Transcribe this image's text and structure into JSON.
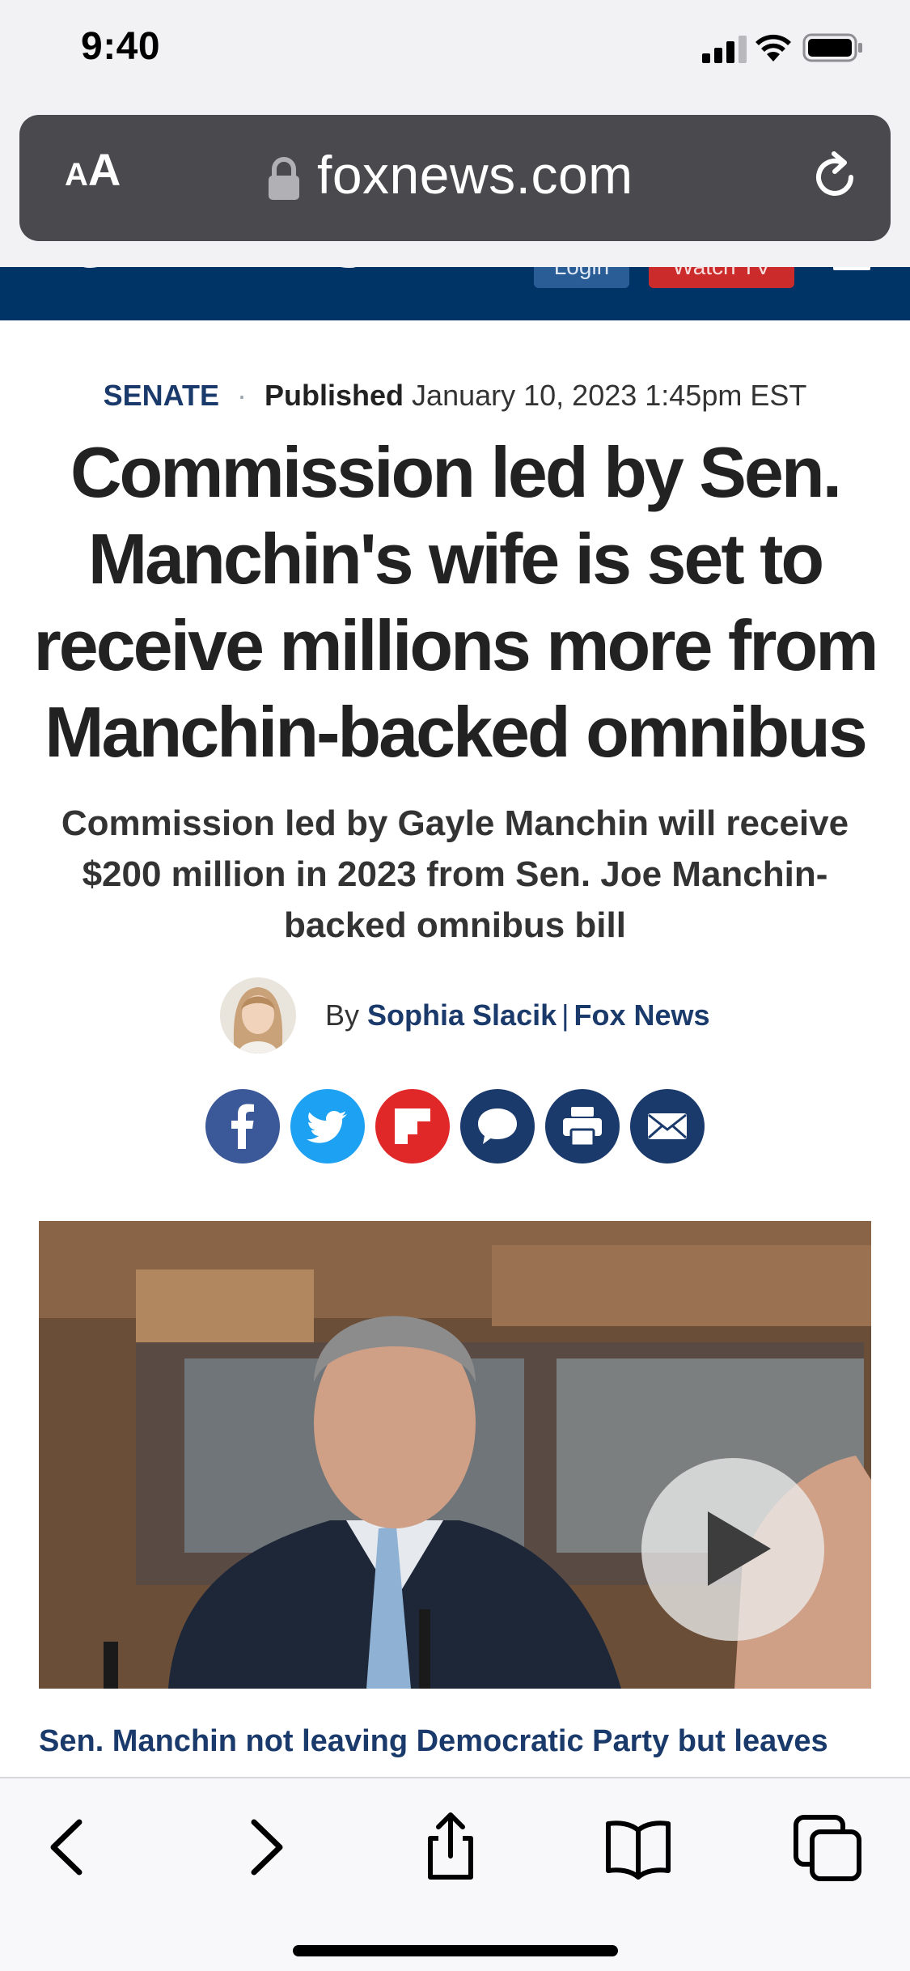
{
  "status_bar": {
    "time": "9:40",
    "icons": [
      "signal-icon",
      "wifi-icon",
      "battery-icon"
    ]
  },
  "browser": {
    "text_size_button": {
      "small": "A",
      "large": "A"
    },
    "url": "foxnews.com",
    "icons": [
      "lock-icon",
      "reload-icon"
    ]
  },
  "site_header": {
    "logo": "FOX NEWS",
    "login_label": "Login",
    "watch_label": "Watch TV",
    "bg_color": "#003366",
    "watch_color": "#cc2b2b"
  },
  "article": {
    "category": "SENATE",
    "separator": "·",
    "published_label": "Published",
    "published_date": "January 10, 2023 1:45pm EST",
    "headline": "Commission led by Sen. Manchin's wife is set to receive millions more from Manchin-backed omnibus",
    "subheadline": "Commission led by Gayle Manchin will receive $200 million in 2023 from Sen. Joe Manchin-backed omnibus bill",
    "byline": {
      "by_label": "By",
      "author": "Sophia Slacik",
      "separator": "|",
      "outlet": "Fox News"
    },
    "share_buttons": [
      {
        "name": "facebook-icon",
        "color": "#3b5998"
      },
      {
        "name": "twitter-icon",
        "color": "#1da1f2"
      },
      {
        "name": "flipboard-icon",
        "color": "#e12828"
      },
      {
        "name": "comments-icon",
        "color": "#1a3a6b"
      },
      {
        "name": "print-icon",
        "color": "#1a3a6b"
      },
      {
        "name": "email-icon",
        "color": "#1a3a6b"
      }
    ],
    "video_caption": "Sen. Manchin not leaving Democratic Party but leaves"
  },
  "bottom_toolbar": {
    "icons": [
      "back-icon",
      "forward-icon",
      "share-icon",
      "bookmarks-icon",
      "tabs-icon"
    ]
  }
}
